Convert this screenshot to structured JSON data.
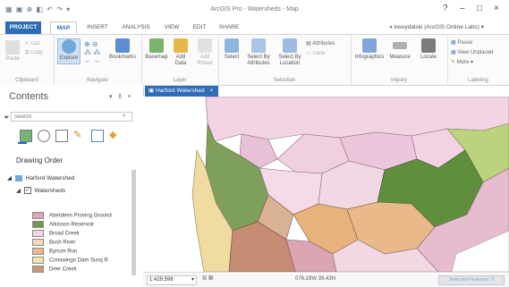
{
  "window": {
    "title": "ArcGIS Pro - Watersheds - Map",
    "controls": [
      "?",
      "–",
      "□",
      "×"
    ]
  },
  "ribbon": {
    "tabs": [
      "PROJECT",
      "MAP",
      "INSERT",
      "ANALYSIS",
      "VIEW",
      "EDIT",
      "SHARE"
    ],
    "active_tab": "MAP",
    "signin": "kwoydalski (ArcGIS Online Labs)",
    "groups": {
      "clipboard": {
        "label": "Clipboard",
        "paste": "Paste",
        "cut": "Cut",
        "copy": "Copy"
      },
      "navigate": {
        "label": "Navigate",
        "explore": "Explore",
        "bookmarks": "Bookmarks"
      },
      "layer": {
        "label": "Layer",
        "basemap": "Basemap",
        "add_data": "Add Data",
        "add_preset": "Add Preset"
      },
      "selection": {
        "label": "Selection",
        "select": "Select",
        "select_by_attributes": "Select By Attributes",
        "select_by_location": "Select By Location",
        "attributes": "Attributes",
        "clear": "Clear"
      },
      "inquiry": {
        "label": "Inquiry",
        "infographics": "Infographics",
        "measure": "Measure",
        "locate": "Locate"
      },
      "labeling": {
        "label": "Labeling",
        "pause": "Pause",
        "view_unplaced": "View Unplaced",
        "more": "More"
      }
    }
  },
  "contents": {
    "title": "Contents",
    "search_placeholder": "Search",
    "drawing_order_label": "Drawing Order",
    "map_name": "Harford Watershed",
    "layer_name": "Watersheds",
    "legend": [
      {
        "label": "Aberdeen Proving Ground",
        "color": "#d9a7b8"
      },
      {
        "label": "Atkisson Reservoir",
        "color": "#6e9a4f"
      },
      {
        "label": "Broad Creek",
        "color": "#f1d6e3"
      },
      {
        "label": "Bush River",
        "color": "#f2d9b8"
      },
      {
        "label": "Bynum Run",
        "color": "#e7b98d"
      },
      {
        "label": "Conowingo Dam Susq R",
        "color": "#f0e6a8"
      },
      {
        "label": "Deer Creek",
        "color": "#c89a7c"
      }
    ]
  },
  "map": {
    "tab_label": "Harford Watershed",
    "scale": "1:429,596",
    "coordinates": "076.29W 39.43N",
    "selected_features": "Selected Features: 0"
  }
}
